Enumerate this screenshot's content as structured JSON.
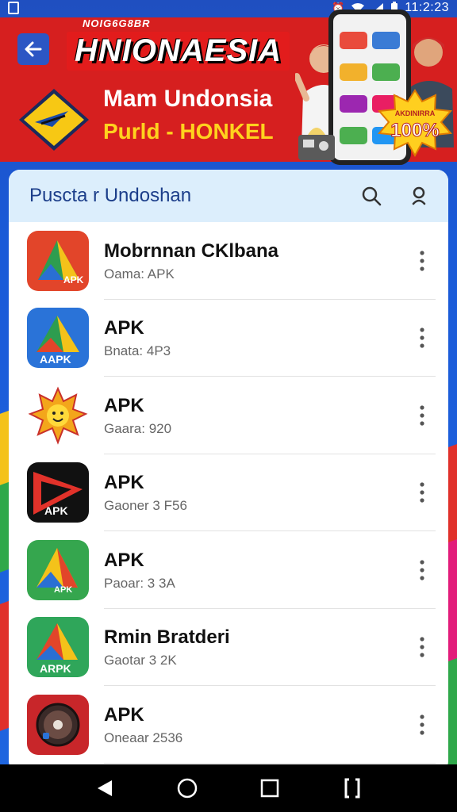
{
  "status_bar": {
    "time": "11:2:23"
  },
  "banner": {
    "kicker": "NOIG6G8BR",
    "headline": "HNIONAESIA",
    "promo_line1": "Mam Undonsia",
    "promo_line2": "Purld - HONKEL",
    "badge_top": "AKDINIRRA",
    "badge_value": "100%"
  },
  "header": {
    "title": "Puscta r Undoshan"
  },
  "apps": [
    {
      "name": "Mobrnnan CKlbana",
      "subtitle": "Oama: APK",
      "icon": "apk-red-icon",
      "badge": "APK",
      "color": "#e2452a"
    },
    {
      "name": "APK",
      "subtitle": "Bnata: 4P3",
      "icon": "apk-blue-icon",
      "badge": "AAPK",
      "color": "#2a73d8"
    },
    {
      "name": "APK",
      "subtitle": "Gaara: 920",
      "icon": "sun-icon",
      "badge": "",
      "color": "#ffffff"
    },
    {
      "name": "APK",
      "subtitle": "Gaoner 3 F56",
      "icon": "apk-black-icon",
      "badge": "APK",
      "color": "#111111"
    },
    {
      "name": "APK",
      "subtitle": "Paoar: 3 3A",
      "icon": "apk-green-icon",
      "badge": "APK",
      "color": "#35a64e"
    },
    {
      "name": "Rmin Bratderi",
      "subtitle": "Gaotar 3 2K",
      "icon": "apk-green-icon",
      "badge": "ARPK",
      "color": "#2fa65a"
    },
    {
      "name": "APK",
      "subtitle": "Oneaar 2536",
      "icon": "record-icon",
      "badge": "",
      "color": "#c8262a"
    }
  ]
}
